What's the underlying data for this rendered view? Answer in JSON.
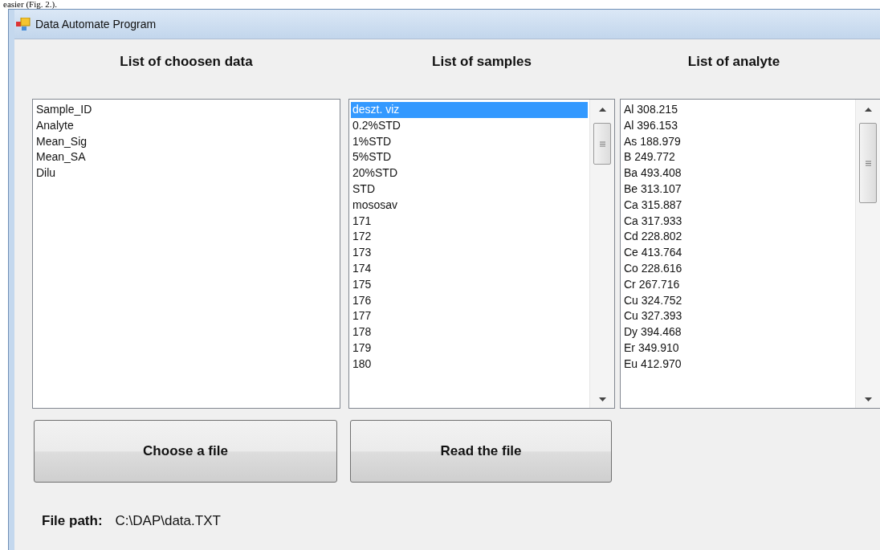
{
  "document_text": "easier (Fig. 2.).",
  "window": {
    "title": "Data Automate Program"
  },
  "lists": [
    {
      "heading": "List of choosen data",
      "scrollable": false,
      "items": [
        {
          "text": "Sample_ID",
          "selected": false
        },
        {
          "text": "Analyte",
          "selected": false
        },
        {
          "text": "Mean_Sig",
          "selected": false
        },
        {
          "text": "Mean_SA",
          "selected": false
        },
        {
          "text": "Dilu",
          "selected": false
        }
      ]
    },
    {
      "heading": "List of samples",
      "scrollable": true,
      "items": [
        {
          "text": "deszt. viz",
          "selected": true
        },
        {
          "text": "0.2%STD",
          "selected": false
        },
        {
          "text": "1%STD",
          "selected": false
        },
        {
          "text": "5%STD",
          "selected": false
        },
        {
          "text": "20%STD",
          "selected": false
        },
        {
          "text": "STD",
          "selected": false
        },
        {
          "text": "mososav",
          "selected": false
        },
        {
          "text": "171",
          "selected": false
        },
        {
          "text": "172",
          "selected": false
        },
        {
          "text": "173",
          "selected": false
        },
        {
          "text": "174",
          "selected": false
        },
        {
          "text": "175",
          "selected": false
        },
        {
          "text": "176",
          "selected": false
        },
        {
          "text": "177",
          "selected": false
        },
        {
          "text": "178",
          "selected": false
        },
        {
          "text": "179",
          "selected": false
        },
        {
          "text": "180",
          "selected": false
        }
      ]
    },
    {
      "heading": "List of analyte",
      "scrollable": true,
      "items": [
        {
          "text": "Al 308.215",
          "selected": false
        },
        {
          "text": "Al 396.153",
          "selected": false
        },
        {
          "text": "As 188.979",
          "selected": false
        },
        {
          "text": "B 249.772",
          "selected": false
        },
        {
          "text": "Ba 493.408",
          "selected": false
        },
        {
          "text": "Be 313.107",
          "selected": false
        },
        {
          "text": "Ca 315.887",
          "selected": false
        },
        {
          "text": "Ca 317.933",
          "selected": false
        },
        {
          "text": "Cd 228.802",
          "selected": false
        },
        {
          "text": "Ce 413.764",
          "selected": false
        },
        {
          "text": "Co 228.616",
          "selected": false
        },
        {
          "text": "Cr 267.716",
          "selected": false
        },
        {
          "text": "Cu 324.752",
          "selected": false
        },
        {
          "text": "Cu 327.393",
          "selected": false
        },
        {
          "text": "Dy 394.468",
          "selected": false
        },
        {
          "text": "Er 349.910",
          "selected": false
        },
        {
          "text": "Eu 412.970",
          "selected": false
        }
      ]
    }
  ],
  "buttons": [
    {
      "label": "Choose a file"
    },
    {
      "label": "Read the file"
    }
  ],
  "file_path": {
    "label": "File path:",
    "value": "C:\\DAP\\data.TXT"
  }
}
